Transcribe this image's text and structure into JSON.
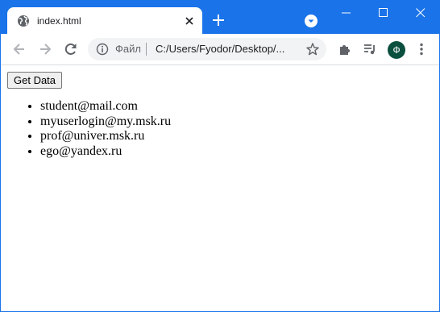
{
  "browser": {
    "tab": {
      "title": "index.html",
      "icon": "globe-icon"
    },
    "omnibox": {
      "scheme_label": "Файл",
      "url": "C:/Users/Fyodor/Desktop/..."
    },
    "profile": {
      "initial": "Ф",
      "color": "#0b4f3f"
    },
    "accent_color": "#1a73e8"
  },
  "page": {
    "button_label": "Get Data",
    "emails": [
      "student@mail.com",
      "myuserlogin@my.msk.ru",
      "prof@univer.msk.ru",
      "ego@yandex.ru"
    ]
  }
}
